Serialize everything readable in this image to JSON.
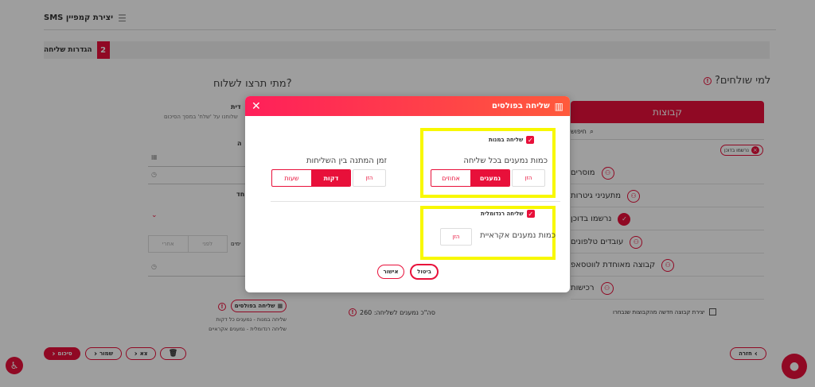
{
  "header": {
    "title": "יצירת קמפיין SMS",
    "menu_icon": "list-icon"
  },
  "step": {
    "number": "2",
    "title": "הגדרות שליחה"
  },
  "groups_panel": {
    "question": "למי שולחים?",
    "tab_label": "קבוצות",
    "search_placeholder": "חיפוש",
    "selected_chip": "נרשמו בדוכן",
    "items": [
      {
        "label": "מוסרים",
        "checked": false
      },
      {
        "label": "מתעניני גיטרות",
        "checked": false
      },
      {
        "label": "נרשמו בדוכן",
        "checked": true
      },
      {
        "label": "עובדים טלפונים",
        "checked": false
      },
      {
        "label": "קבוצה מאוחדת לווטסאפ",
        "checked": false
      },
      {
        "label": "רכישות",
        "checked": false
      }
    ],
    "create_group_label": "יצירת קבוצה חדשה מהקבוצות שנבחרו",
    "total_recipients": "סה\"כ נמענים לשליחה: 260"
  },
  "when_panel": {
    "question": "מתי תרצו לשלוח?",
    "immediate_title": "דית",
    "immediate_desc": "שלוחנו על 'שלח' במסך הסיכום",
    "field_label_1": "ה",
    "field_label_2": "חד",
    "days_label": "ימים",
    "from_placeholder": "לפני",
    "after_placeholder": "אחרי",
    "batches_button": "שליחה בפולסים",
    "batch_summary_1": "שליחה במנות - נמענים כל דקות",
    "batch_summary_2": "שליחה רנדומלית - נמענים אקראיים"
  },
  "modal": {
    "title": "שליחה בפולסים",
    "batch_section": {
      "checkbox_label": "שליחה במנות",
      "checked": true,
      "recipients_per_send_label": "כמות נמענים בכל שליחה",
      "input_placeholder": "הזן",
      "unit_options": [
        "נמענים",
        "אחוזים"
      ],
      "selected_unit": "נמענים"
    },
    "wait_section": {
      "label": "זמן המתנה בין השליחות",
      "input_placeholder": "הזן",
      "unit_options": [
        "דקות",
        "שעות"
      ],
      "selected_unit": "דקות"
    },
    "random_section": {
      "checkbox_label": "שליחה רנדומלית",
      "checked": true,
      "random_recipients_label": "כמות נמענים אקראיית",
      "input_placeholder": "הזן"
    },
    "cancel_label": "ביטול",
    "confirm_label": "אישור"
  },
  "footer": {
    "back_label": "חזרה",
    "summary_label": "סיכום",
    "save_label": "שמור",
    "exit_label": "צא"
  },
  "colors": {
    "accent": "#e8103a",
    "highlight": "#f8f800",
    "gradient_start": "#ff1f5a",
    "gradient_end": "#ff5a3c"
  }
}
